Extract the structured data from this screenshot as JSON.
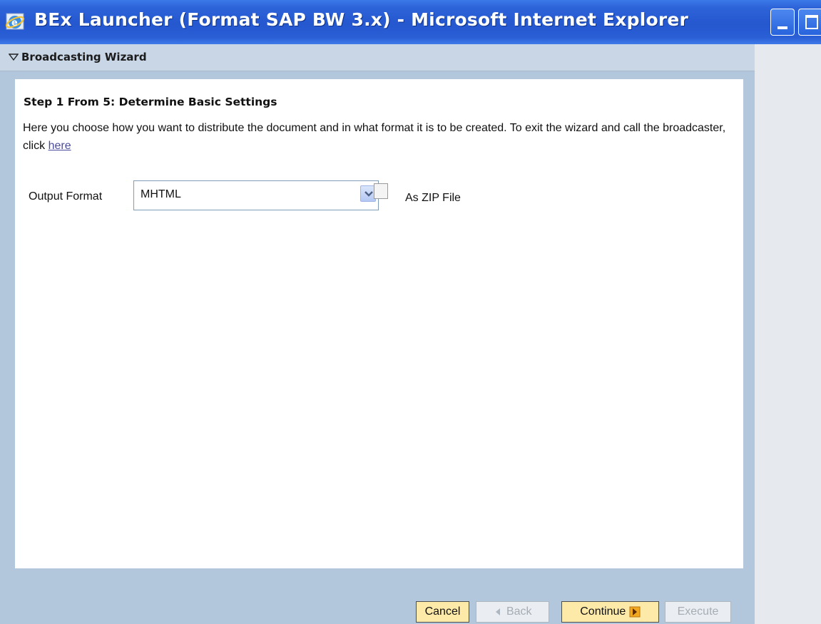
{
  "window": {
    "title": "BEx Launcher (Format SAP BW 3.x) - Microsoft Internet Explorer",
    "icon": "ie-icon",
    "controls": [
      "minimize-icon",
      "maximize-icon"
    ]
  },
  "wizard": {
    "header": "Broadcasting Wizard",
    "step_title": "Step 1 From 5: Determine Basic Settings",
    "description": "Here you choose how you want to distribute the document and in what format it is to be created. To exit the wizard and call the broadcaster, click ",
    "link_text": "here",
    "output_format": {
      "label": "Output Format",
      "value": "MHTML"
    },
    "zip": {
      "label": "As ZIP File",
      "checked": false
    }
  },
  "buttons": {
    "cancel": "Cancel",
    "back": "Back",
    "continue": "Continue",
    "execute": "Execute"
  },
  "colors": {
    "titlebar": "#2557cf",
    "wizard_bg": "#b3c7dc",
    "button_active": "#fde9a8",
    "button_disabled": "#eaeef2"
  }
}
